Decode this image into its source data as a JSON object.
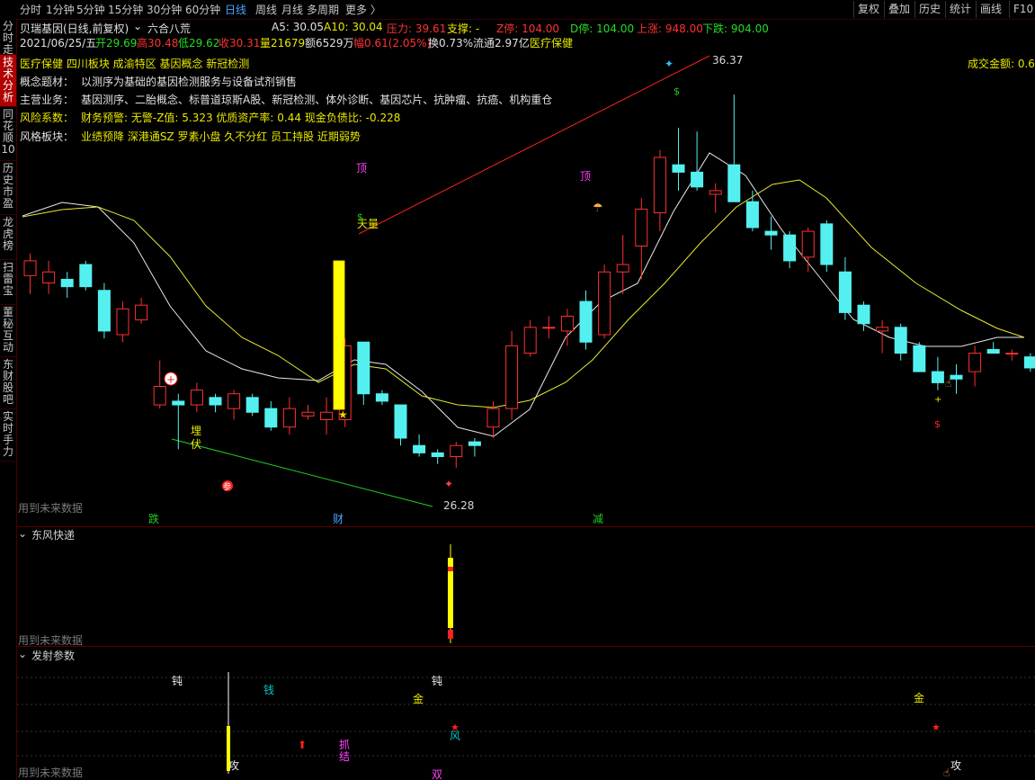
{
  "toolbar": {
    "periods": [
      "分时",
      "1分钟",
      "5分钟",
      "15分钟",
      "30分钟",
      "60分钟",
      "日线",
      "周线",
      "月线",
      "多周期",
      "更多 〉"
    ],
    "active": "日线",
    "right_buttons": [
      "复权",
      "叠加",
      "历史",
      "统计",
      "画线",
      "F10"
    ]
  },
  "sidebar": {
    "tabs": [
      "分时走势",
      "技术分析",
      "同花顺10",
      "历史市盈",
      "龙虎榜",
      "扫雷宝",
      "董秘互动",
      "东财股吧",
      "实时手力"
    ],
    "active": "技术分析"
  },
  "header": {
    "title": "贝瑞基因(日线,前复权)",
    "indicator": "六合八荒",
    "a5": "A5: 30.05",
    "a10": "A10: 30.04",
    "pressure": "压力: 39.61",
    "support": "支撑: -",
    "zting": "Z停: 104.00",
    "dting": "D停: 104.00",
    "up": "上涨: 948.00",
    "down": "下跌: 904.00"
  },
  "quote": {
    "date": "2021/06/25/五",
    "open": "开29.69",
    "high": "高30.48",
    "low": "低29.62",
    "close": "收30.31",
    "volume": "量21679",
    "amount": "额6529万",
    "change": "幅0.61(2.05%)",
    "turnover": "换0.73%",
    "float": "流通2.97亿",
    "industry": "医疗保健"
  },
  "tags": "医疗保健 四川板块 成渝特区 基因概念 新冠检测",
  "amount_label": "成交金额: 0.6",
  "concept": {
    "label": "概念题材：",
    "text": "以测序为基础的基因检测服务与设备试剂销售"
  },
  "business": {
    "label": "主营业务：",
    "text": "基因测序、二胎概念、标普道琼斯A股、新冠检测、体外诊断、基因芯片、抗肿瘤、抗癌、机构重仓"
  },
  "risk": {
    "label": "风险系数：",
    "text": "财务预警: 无警-Z值: 5.323 优质资产率: 0.44 现金负债比: -0.228"
  },
  "style": {
    "label": "风格板块：",
    "text": "业绩预降 深港通SZ 罗素小盘 久不分红 员工持股 近期弱势"
  },
  "main_chart": {
    "high_label": "36.37",
    "low_label": "26.28",
    "signals": [
      "顶",
      "天量",
      "顶",
      "埋",
      "伏",
      "参",
      "跌",
      "财",
      "减"
    ],
    "future": "用到未来数据"
  },
  "panel2": {
    "title": "东风快递",
    "future": "用到未来数据"
  },
  "panel3": {
    "title": "发射参数",
    "future": "用到未来数据",
    "labels": [
      "钝",
      "钱",
      "钝",
      "金",
      "金",
      "抓",
      "结",
      "风",
      "攻",
      "双",
      "攻"
    ]
  },
  "chart_data": {
    "type": "candlestick",
    "price_range": [
      25.2,
      37.5
    ],
    "candles": [
      {
        "o": 31.5,
        "h": 32.1,
        "l": 31.0,
        "c": 31.9
      },
      {
        "o": 31.3,
        "h": 31.9,
        "l": 31.0,
        "c": 31.6
      },
      {
        "o": 31.4,
        "h": 31.6,
        "l": 30.9,
        "c": 31.2
      },
      {
        "o": 31.8,
        "h": 31.9,
        "l": 31.1,
        "c": 31.2
      },
      {
        "o": 31.1,
        "h": 31.3,
        "l": 29.8,
        "c": 30.0
      },
      {
        "o": 29.9,
        "h": 30.8,
        "l": 29.7,
        "c": 30.6
      },
      {
        "o": 30.3,
        "h": 30.9,
        "l": 30.2,
        "c": 30.7
      },
      {
        "o": 28.0,
        "h": 29.2,
        "l": 27.9,
        "c": 28.5
      },
      {
        "o": 28.1,
        "h": 28.3,
        "l": 26.8,
        "c": 28.0
      },
      {
        "o": 28.0,
        "h": 28.6,
        "l": 27.8,
        "c": 28.4
      },
      {
        "o": 28.2,
        "h": 28.3,
        "l": 27.8,
        "c": 28.0
      },
      {
        "o": 27.9,
        "h": 28.4,
        "l": 27.6,
        "c": 28.3
      },
      {
        "o": 28.2,
        "h": 28.3,
        "l": 27.7,
        "c": 27.8
      },
      {
        "o": 27.9,
        "h": 28.1,
        "l": 27.3,
        "c": 27.4
      },
      {
        "o": 27.4,
        "h": 28.2,
        "l": 27.2,
        "c": 27.9
      },
      {
        "o": 27.7,
        "h": 28.0,
        "l": 27.6,
        "c": 27.8
      },
      {
        "o": 27.6,
        "h": 28.2,
        "l": 27.2,
        "c": 27.8
      },
      {
        "o": 27.6,
        "h": 29.8,
        "l": 27.4,
        "c": 29.6
      },
      {
        "o": 29.7,
        "h": 29.7,
        "l": 28.0,
        "c": 28.3
      },
      {
        "o": 28.3,
        "h": 28.4,
        "l": 28.0,
        "c": 28.1
      },
      {
        "o": 28.0,
        "h": 28.0,
        "l": 26.9,
        "c": 27.1
      },
      {
        "o": 26.9,
        "h": 27.2,
        "l": 26.6,
        "c": 26.7
      },
      {
        "o": 26.7,
        "h": 26.8,
        "l": 26.4,
        "c": 26.6
      },
      {
        "o": 26.6,
        "h": 27.0,
        "l": 26.3,
        "c": 26.9
      },
      {
        "o": 27.0,
        "h": 27.1,
        "l": 26.6,
        "c": 26.9
      },
      {
        "o": 27.4,
        "h": 28.1,
        "l": 27.1,
        "c": 27.9
      },
      {
        "o": 27.9,
        "h": 30.0,
        "l": 27.6,
        "c": 29.6
      },
      {
        "o": 29.4,
        "h": 30.3,
        "l": 29.3,
        "c": 30.1
      },
      {
        "o": 30.1,
        "h": 30.4,
        "l": 29.8,
        "c": 30.1
      },
      {
        "o": 30.0,
        "h": 30.6,
        "l": 29.6,
        "c": 30.4
      },
      {
        "o": 30.8,
        "h": 31.1,
        "l": 29.5,
        "c": 29.7
      },
      {
        "o": 29.9,
        "h": 31.8,
        "l": 29.8,
        "c": 31.6
      },
      {
        "o": 31.6,
        "h": 32.6,
        "l": 31.0,
        "c": 31.8
      },
      {
        "o": 32.3,
        "h": 33.6,
        "l": 31.4,
        "c": 33.3
      },
      {
        "o": 33.2,
        "h": 34.9,
        "l": 32.7,
        "c": 34.7
      },
      {
        "o": 34.5,
        "h": 35.5,
        "l": 33.8,
        "c": 34.3
      },
      {
        "o": 34.3,
        "h": 35.4,
        "l": 33.8,
        "c": 33.9
      },
      {
        "o": 33.7,
        "h": 34.0,
        "l": 33.2,
        "c": 33.8
      },
      {
        "o": 34.5,
        "h": 36.4,
        "l": 33.5,
        "c": 33.5
      },
      {
        "o": 33.5,
        "h": 33.8,
        "l": 32.7,
        "c": 32.8
      },
      {
        "o": 32.7,
        "h": 33.1,
        "l": 32.2,
        "c": 32.6
      },
      {
        "o": 32.6,
        "h": 32.7,
        "l": 31.7,
        "c": 31.9
      },
      {
        "o": 32.0,
        "h": 32.8,
        "l": 31.6,
        "c": 32.7
      },
      {
        "o": 32.9,
        "h": 33.0,
        "l": 31.6,
        "c": 31.8
      },
      {
        "o": 31.6,
        "h": 32.0,
        "l": 30.3,
        "c": 30.5
      },
      {
        "o": 30.7,
        "h": 30.8,
        "l": 30.0,
        "c": 30.2
      },
      {
        "o": 30.0,
        "h": 30.3,
        "l": 29.4,
        "c": 30.1
      },
      {
        "o": 30.1,
        "h": 30.2,
        "l": 29.2,
        "c": 29.4
      },
      {
        "o": 29.6,
        "h": 29.7,
        "l": 28.9,
        "c": 28.9
      },
      {
        "o": 28.9,
        "h": 29.3,
        "l": 28.4,
        "c": 28.6
      },
      {
        "o": 28.8,
        "h": 29.1,
        "l": 28.3,
        "c": 28.7
      },
      {
        "o": 28.9,
        "h": 29.6,
        "l": 28.5,
        "c": 29.4
      },
      {
        "o": 29.5,
        "h": 29.7,
        "l": 29.4,
        "c": 29.4
      },
      {
        "o": 29.4,
        "h": 29.5,
        "l": 29.2,
        "c": 29.4
      },
      {
        "o": 29.3,
        "h": 29.4,
        "l": 28.9,
        "c": 29.0
      },
      {
        "o": 29.1,
        "h": 29.8,
        "l": 28.9,
        "c": 29.7
      }
    ]
  }
}
